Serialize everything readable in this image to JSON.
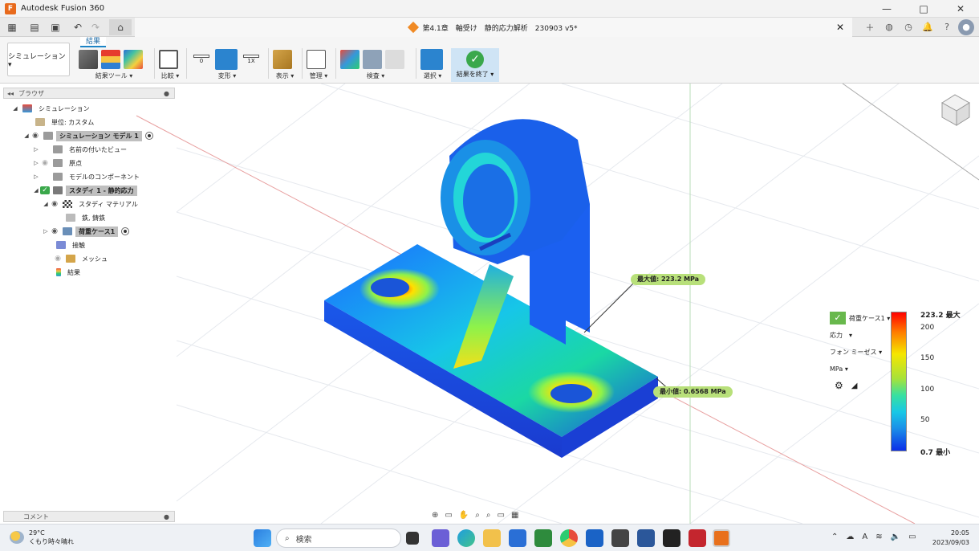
{
  "window": {
    "title": "Autodesk Fusion 360",
    "controls": [
      "—",
      "□",
      "✕"
    ]
  },
  "tabbar": {
    "document_title": "第4.1章　軸受け　静的応力解析　230903 v5*"
  },
  "ribbon": {
    "active_tab": "結果",
    "workspace": "シミュレーション ▾",
    "groups": {
      "results_tools": "結果ツール ▾",
      "compare": "比較 ▾",
      "deform": "変形 ▾",
      "display": "表示 ▾",
      "manage": "管理 ▾",
      "inspect": "検査 ▾",
      "select": "選択 ▾",
      "finish": "結果を終了 ▾"
    },
    "deform_values": [
      "0",
      "1X"
    ]
  },
  "browser": {
    "title": "ブラウザ",
    "items": [
      {
        "label": "シミュレーション"
      },
      {
        "label": "単位: カスタム"
      },
      {
        "label": "シミュレーション モデル 1"
      },
      {
        "label": "名前の付いたビュー"
      },
      {
        "label": "原点"
      },
      {
        "label": "モデルのコンポーネント"
      },
      {
        "label": "スタディ 1 - 静的応力"
      },
      {
        "label": "スタディ マテリアル"
      },
      {
        "label": "鉄, 鋳鉄"
      },
      {
        "label": "荷重ケース1"
      },
      {
        "label": "接触"
      },
      {
        "label": "メッシュ"
      },
      {
        "label": "結果"
      }
    ]
  },
  "comments": {
    "title": "コメント"
  },
  "viewport": {
    "max_label": "最大値: 223.2 MPa",
    "min_label": "最小値: 0.6568 MPa"
  },
  "legend": {
    "load_case": "荷重ケース1 ▾",
    "result_type": "応力　▾",
    "criterion": "フォン ミーゼス ▾",
    "units": "MPa ▾",
    "ticks": [
      {
        "label": "223.2 最大"
      },
      {
        "label": "200"
      },
      {
        "label": "150"
      },
      {
        "label": "100"
      },
      {
        "label": "50"
      },
      {
        "label": "0.7 最小"
      }
    ]
  },
  "taskbar": {
    "weather_temp": "29°C",
    "weather_desc": "くもり時々晴れ",
    "search_placeholder": "検索",
    "time": "20:05",
    "date": "2023/09/03"
  },
  "colors": {
    "accent": "#1c84c6",
    "finish_bg": "#cfe4f5",
    "check_green": "#3aa84b",
    "label_green": "#b8e07a"
  }
}
